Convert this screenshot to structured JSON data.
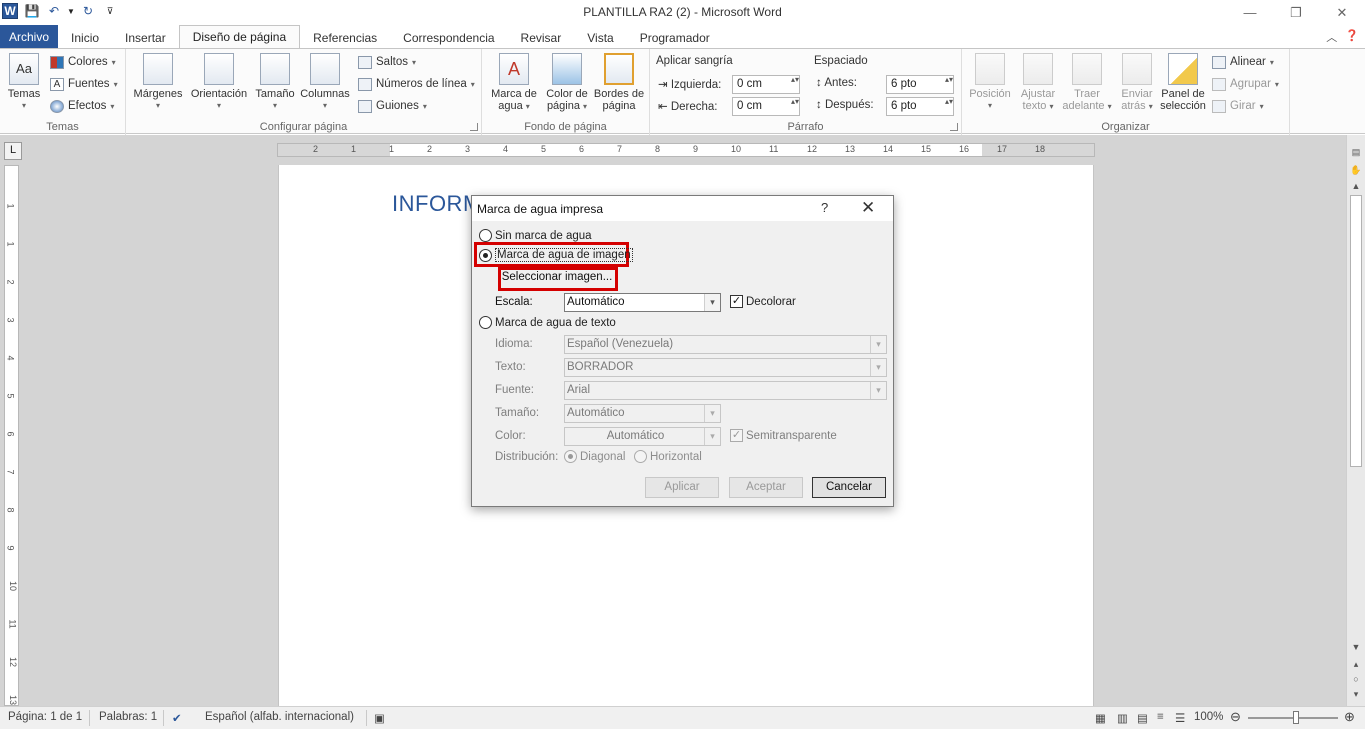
{
  "window": {
    "title": "PLANTILLA RA2 (2)  -  Microsoft Word"
  },
  "tabs": [
    "Archivo",
    "Inicio",
    "Insertar",
    "Diseño de página",
    "Referencias",
    "Correspondencia",
    "Revisar",
    "Vista",
    "Programador"
  ],
  "active_tab": "Diseño de página",
  "ribbon": {
    "temas": {
      "label": "Temas",
      "temas_btn": "Temas",
      "colores": "Colores",
      "fuentes": "Fuentes",
      "efectos": "Efectos"
    },
    "configurar": {
      "label": "Configurar página",
      "margenes": "Márgenes",
      "orientacion": "Orientación",
      "tamano": "Tamaño",
      "columnas": "Columnas",
      "saltos": "Saltos",
      "numeros_linea": "Números de línea",
      "guiones": "Guiones"
    },
    "fondo": {
      "label": "Fondo de página",
      "marca_agua_1": "Marca de",
      "marca_agua_2": "agua",
      "color_pagina_1": "Color de",
      "color_pagina_2": "página",
      "bordes_1": "Bordes de",
      "bordes_2": "página"
    },
    "parrafo": {
      "label": "Párrafo",
      "sangria": "Aplicar sangría",
      "izquierda_label": "Izquierda:",
      "izquierda_value": "0 cm",
      "derecha_label": "Derecha:",
      "derecha_value": "0 cm",
      "espaciado": "Espaciado",
      "antes_label": "Antes:",
      "antes_value": "6 pto",
      "despues_label": "Después:",
      "despues_value": "6 pto"
    },
    "organizar": {
      "label": "Organizar",
      "posicion": "Posición",
      "ajustar_1": "Ajustar",
      "ajustar_2": "texto",
      "traer_1": "Traer",
      "traer_2": "adelante",
      "enviar_1": "Enviar",
      "enviar_2": "atrás",
      "panel_1": "Panel de",
      "panel_2": "selección",
      "alinear": "Alinear",
      "agrupar": "Agrupar",
      "girar": "Girar"
    }
  },
  "document": {
    "heading": "INFORM"
  },
  "ruler": {
    "h_numbers": [
      "2",
      "1",
      "1",
      "2",
      "3",
      "4",
      "5",
      "6",
      "7",
      "8",
      "9",
      "10",
      "11",
      "12",
      "13",
      "14",
      "15",
      "16",
      "17",
      "18"
    ],
    "v_numbers": [
      "1",
      "1",
      "2",
      "3",
      "4",
      "5",
      "6",
      "7",
      "8",
      "9",
      "10",
      "11",
      "12",
      "13",
      "14"
    ]
  },
  "dialog": {
    "title": "Marca de agua impresa",
    "help": "?",
    "close": "✕",
    "sin_marca": "Sin marca de agua",
    "marca_imagen": "Marca de agua de imagen",
    "seleccionar_imagen": "Seleccionar imagen...",
    "escala_label": "Escala:",
    "escala_value": "Automático",
    "decolorar": "Decolorar",
    "marca_texto": "Marca de agua de texto",
    "idioma_label": "Idioma:",
    "idioma_value": "Español (Venezuela)",
    "texto_label": "Texto:",
    "texto_value": "BORRADOR",
    "fuente_label": "Fuente:",
    "fuente_value": "Arial",
    "tamano_label": "Tamaño:",
    "tamano_value": "Automático",
    "color_label": "Color:",
    "color_value": "Automático",
    "semitransparente": "Semitransparente",
    "distribucion_label": "Distribución:",
    "diagonal": "Diagonal",
    "horizontal": "Horizontal",
    "aplicar": "Aplicar",
    "aceptar": "Aceptar",
    "cancelar": "Cancelar"
  },
  "statusbar": {
    "pagina": "Página: 1 de 1",
    "palabras": "Palabras: 1",
    "idioma": "Español (alfab. internacional)",
    "zoom": "100%"
  },
  "colors": {
    "accent": "#2b579a",
    "highlight": "#d40000"
  }
}
